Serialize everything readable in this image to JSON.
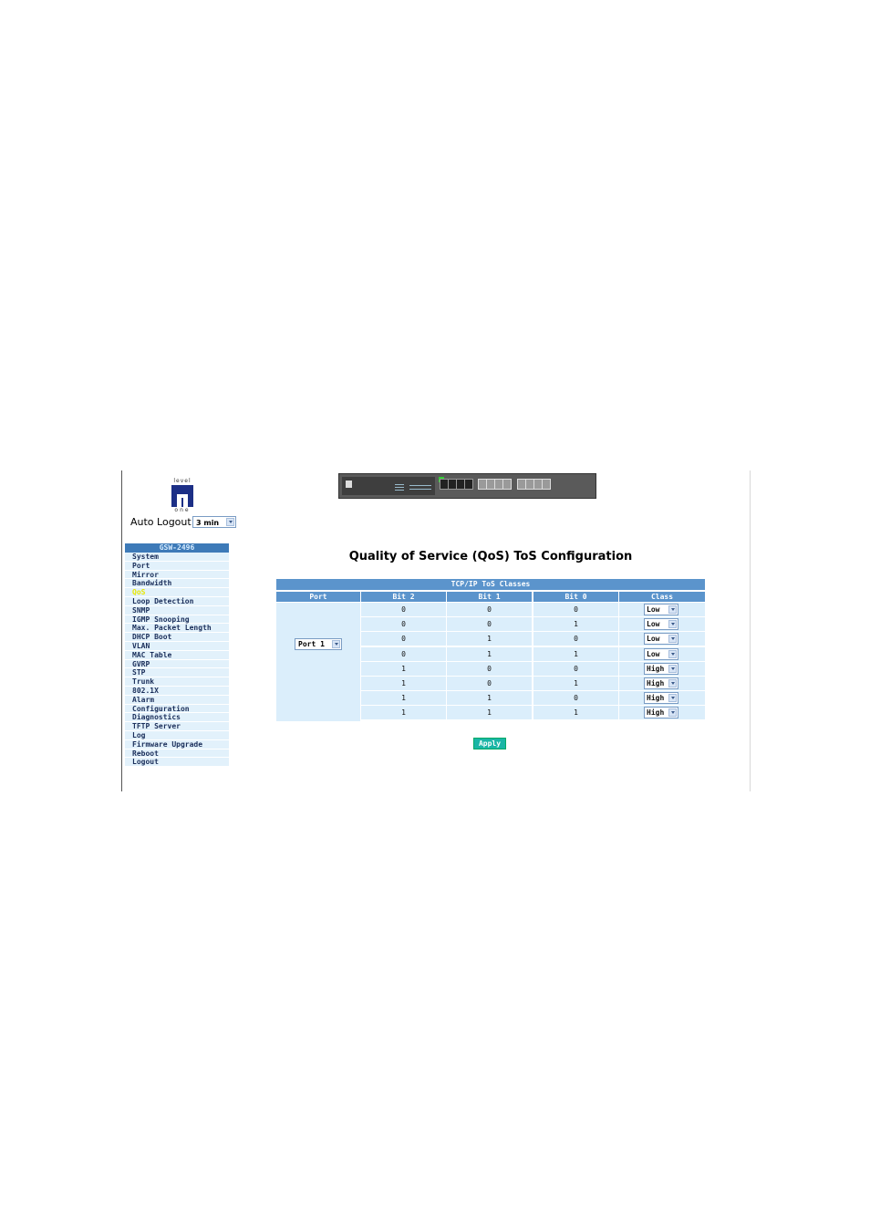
{
  "logo": {
    "top_text": "level",
    "bottom_text": "one"
  },
  "auto_logout": {
    "label": "Auto Logout",
    "value": "3 min"
  },
  "sidebar": {
    "title": "GSW-2496",
    "items": [
      {
        "label": "System"
      },
      {
        "label": "Port"
      },
      {
        "label": "Mirror"
      },
      {
        "label": "Bandwidth"
      },
      {
        "label": "QoS",
        "active": true
      },
      {
        "label": "Loop Detection"
      },
      {
        "label": "SNMP"
      },
      {
        "label": "IGMP Snooping"
      },
      {
        "label": "Max. Packet Length"
      },
      {
        "label": "DHCP Boot"
      },
      {
        "label": "VLAN"
      },
      {
        "label": "MAC Table"
      },
      {
        "label": "GVRP"
      },
      {
        "label": "STP"
      },
      {
        "label": "Trunk"
      },
      {
        "label": "802.1X"
      },
      {
        "label": "Alarm"
      },
      {
        "label": "Configuration"
      },
      {
        "label": "Diagnostics"
      },
      {
        "label": "TFTP Server"
      },
      {
        "label": "Log"
      },
      {
        "label": "Firmware Upgrade"
      },
      {
        "label": "Reboot"
      },
      {
        "label": "Logout"
      }
    ]
  },
  "main": {
    "title": "Quality of Service (QoS) ToS Configuration",
    "table": {
      "caption": "TCP/IP ToS Classes",
      "headers": [
        "Port",
        "Bit 2",
        "Bit 1",
        "Bit 0",
        "Class"
      ],
      "port_value": "Port 1",
      "rows": [
        {
          "bit2": "0",
          "bit1": "0",
          "bit0": "0",
          "class": "Low"
        },
        {
          "bit2": "0",
          "bit1": "0",
          "bit0": "1",
          "class": "Low"
        },
        {
          "bit2": "0",
          "bit1": "1",
          "bit0": "0",
          "class": "Low"
        },
        {
          "bit2": "0",
          "bit1": "1",
          "bit0": "1",
          "class": "Low"
        },
        {
          "bit2": "1",
          "bit1": "0",
          "bit0": "0",
          "class": "High"
        },
        {
          "bit2": "1",
          "bit1": "0",
          "bit0": "1",
          "class": "High"
        },
        {
          "bit2": "1",
          "bit1": "1",
          "bit0": "0",
          "class": "High"
        },
        {
          "bit2": "1",
          "bit1": "1",
          "bit0": "1",
          "class": "High"
        }
      ]
    },
    "apply_label": "Apply"
  }
}
